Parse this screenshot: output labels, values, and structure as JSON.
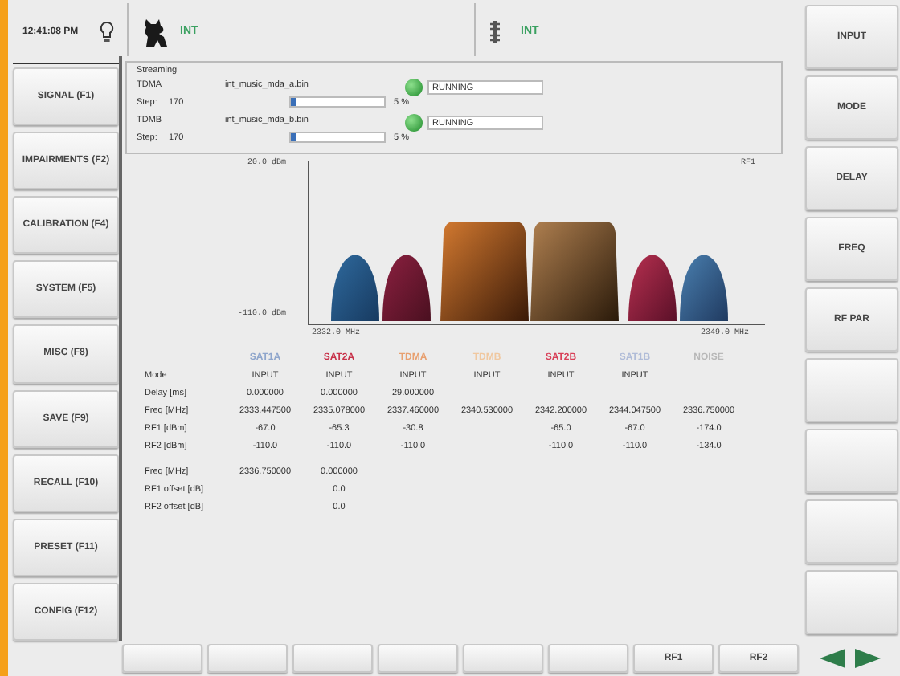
{
  "status_bar": {
    "time": "12:41:08 PM",
    "source_1": "INT",
    "source_2": "INT"
  },
  "left_softkeys": [
    "SIGNAL (F1)",
    "IMPAIRMENTS (F2)",
    "CALIBRATION (F4)",
    "SYSTEM (F5)",
    "MISC (F8)",
    "SAVE (F9)",
    "RECALL (F10)",
    "PRESET (F11)",
    "CONFIG (F12)"
  ],
  "right_softkeys": [
    {
      "kind": "label",
      "label": "INPUT"
    },
    {
      "kind": "label",
      "label": "MODE"
    },
    {
      "kind": "label",
      "label": "DELAY"
    },
    {
      "kind": "label",
      "label": "FREQ"
    },
    {
      "kind": "label",
      "label": "RF PAR"
    },
    {
      "kind": "blank"
    },
    {
      "kind": "blank"
    },
    {
      "kind": "blank"
    },
    {
      "kind": "blank"
    }
  ],
  "streaming": {
    "title": "Streaming",
    "streams": [
      {
        "name": "TDMA",
        "file": "int_music_mda_a.bin",
        "step_label": "Step:",
        "step": "170",
        "level": 0.05,
        "percent": "5 %",
        "running": true,
        "status": "RUNNING"
      },
      {
        "name": "TDMB",
        "file": "int_music_mda_b.bin",
        "step_label": "Step:",
        "step": "170",
        "level": 0.05,
        "percent": "5 %",
        "running": true,
        "status": "RUNNING"
      }
    ]
  },
  "spectrum": {
    "y_top": "20.0 dBm",
    "y_bottom": "-110.0 dBm",
    "x_left": "2332.0 MHz",
    "x_right": "2349.0 MHz",
    "trace": "RF1"
  },
  "table": {
    "columns": [
      {
        "label": "SAT1A",
        "color": "#8fa6cc"
      },
      {
        "label": "SAT2A",
        "color": "#c8324a"
      },
      {
        "label": "TDMA",
        "color": "#e8a070"
      },
      {
        "label": "TDMB",
        "color": "#f0c8a0"
      },
      {
        "label": "SAT2B",
        "color": "#d84058"
      },
      {
        "label": "SAT1B",
        "color": "#b0bcd8"
      },
      {
        "label": "NOISE",
        "color": "#b8b8b8"
      }
    ],
    "rows": [
      {
        "label": "Mode",
        "cells": [
          "INPUT",
          "INPUT",
          "INPUT",
          "INPUT",
          "INPUT",
          "INPUT",
          ""
        ]
      },
      {
        "label": "Delay [ms]",
        "cells": [
          "0.000000",
          "0.000000",
          "29.000000",
          "",
          "",
          "",
          ""
        ]
      },
      {
        "label": "Freq [MHz]",
        "cells": [
          "2333.447500",
          "2335.078000",
          "2337.460000",
          "2340.530000",
          "2342.200000",
          "2344.047500",
          "2336.750000"
        ]
      },
      {
        "label": "RF1 [dBm]",
        "cells": [
          "-67.0",
          "-65.3",
          "-30.8",
          "",
          "-65.0",
          "-67.0",
          "-174.0"
        ]
      },
      {
        "label": "RF2 [dBm]",
        "cells": [
          "-110.0",
          "-110.0",
          "-110.0",
          "",
          "-110.0",
          "-110.0",
          "-134.0"
        ]
      }
    ]
  },
  "noise_settings": [
    {
      "label": "Freq [MHz]",
      "value_1": "2336.750000",
      "value_2": "0.000000"
    },
    {
      "label": "RF1 offset [dB]",
      "value_2": "0.0"
    },
    {
      "label": "RF2 offset [dB]",
      "value_2": "0.0"
    }
  ],
  "bottom_softkeys": [
    {
      "kind": "blank"
    },
    {
      "kind": "blank"
    },
    {
      "kind": "blank"
    },
    {
      "kind": "blank"
    },
    {
      "kind": "blank"
    },
    {
      "kind": "blank"
    },
    {
      "kind": "label",
      "label": "RF1"
    },
    {
      "kind": "label",
      "label": "RF2"
    }
  ]
}
